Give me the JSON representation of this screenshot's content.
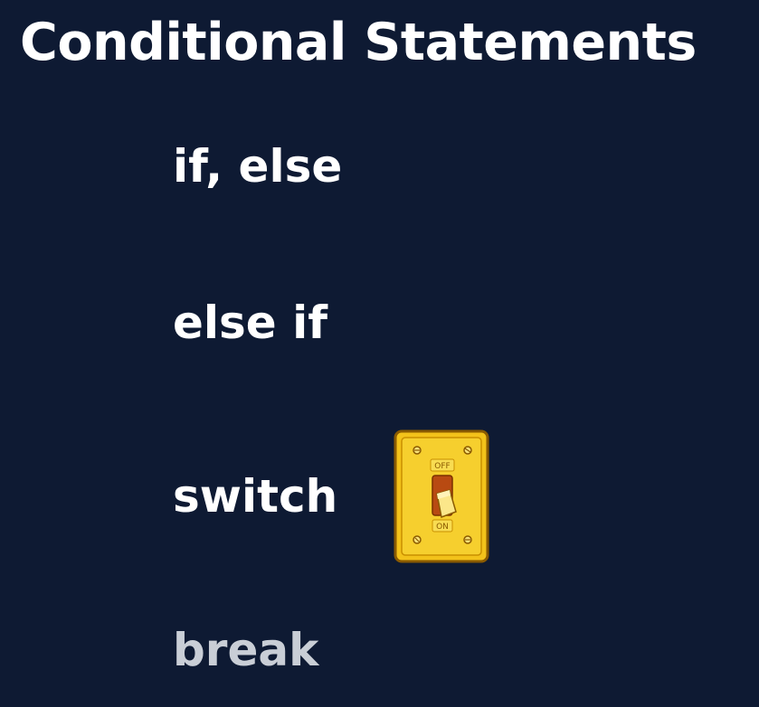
{
  "slide": {
    "title": "Conditional Statements",
    "items": [
      {
        "label": "if, else"
      },
      {
        "label": "else if"
      },
      {
        "label": "switch"
      },
      {
        "label": "break"
      }
    ]
  },
  "illustration": {
    "icon": "light-switch-icon",
    "off_label": "OFF",
    "on_label": "ON",
    "plate_color": "#f3c21a",
    "outline_color": "#8a5a00"
  },
  "colors": {
    "background": "#0e1a33",
    "text": "#ffffff",
    "muted_text": "#c9ced6"
  }
}
